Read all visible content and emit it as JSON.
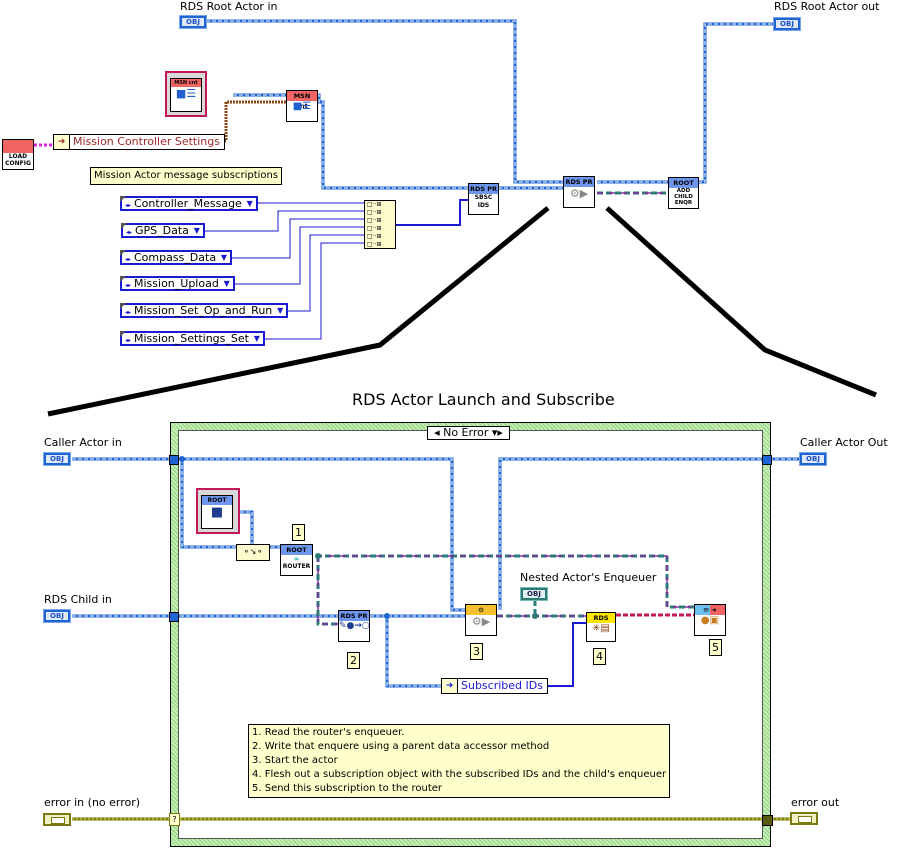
{
  "top": {
    "rds_root_in_label": "RDS Root Actor in",
    "rds_root_out_label": "RDS Root Actor out",
    "obj_text": "OBJ",
    "load_config": [
      "LOAD",
      "CONFIG"
    ],
    "mission_controller_settings": "Mission Controller Settings",
    "subscriptions_note": "Mission Actor message subscriptions",
    "msn_class_label": "MSN cnt",
    "subscriptions": [
      "Controller_Message",
      "GPS_Data",
      "Compass_Data",
      "Mission_Upload",
      "Mission_Set_Op_and_Run",
      "Mission_Settings_Set"
    ],
    "subvi_sbsc": {
      "header": "RDS PR",
      "body": [
        "SBSC",
        "IDS"
      ]
    },
    "subvi_launch": {
      "header": "RDS PR"
    },
    "subvi_root_add": {
      "header": "ROOT",
      "body": [
        "ADD",
        "CHILD",
        "ENQR"
      ]
    }
  },
  "zoom_view": {
    "title": "RDS Actor Launch and Subscribe",
    "case_selector": "No Error",
    "caller_actor_in": "Caller Actor in",
    "caller_actor_out": "Caller Actor Out",
    "rds_child_in": "RDS Child in",
    "nested_enqueuer": "Nested Actor's Enqueuer",
    "subscribed_ids": "Subscribed IDs",
    "error_in": "error in (no error)",
    "error_out": "error out",
    "root_class_label": "ROOT",
    "router_vi": {
      "header": "ROOT",
      "body": "ROUTER"
    },
    "accessor_vi": {
      "header": "RDS PR"
    },
    "subscription_vi": {
      "header": "RDS"
    },
    "step_numbers": [
      "1",
      "2",
      "3",
      "4",
      "5"
    ],
    "steps": [
      "1. Read the router's enqueuer.",
      "2. Write that enquere using a parent data accessor method",
      "3. Start the actor",
      "4. Flesh out a subscription object with the subscribed IDs and the child's enqueuer",
      "5. Send this subscription to the router"
    ]
  },
  "colors": {
    "class_wire": "#1e64d2",
    "enqueuer_wire": "#2a7a78",
    "error_wire": "#7a7a10",
    "enum_wire": "#1a1ad0",
    "cluster_wire": "#8b4513",
    "message_wire": "#c0185a",
    "case_border": "#8fd47f"
  }
}
